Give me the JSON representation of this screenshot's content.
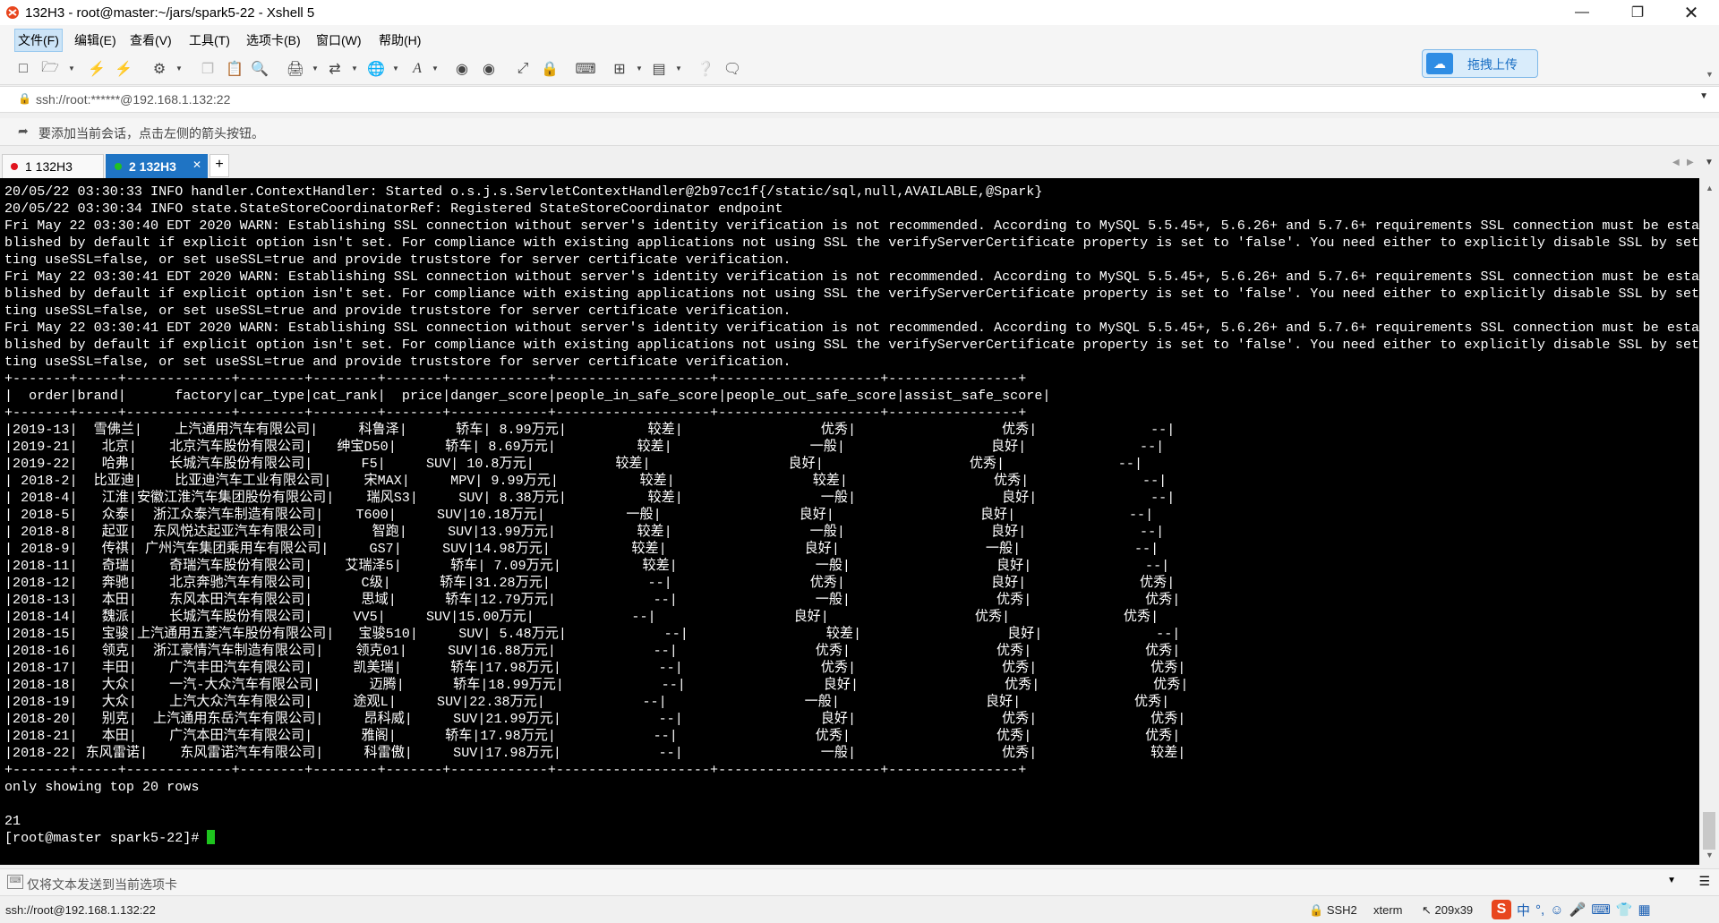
{
  "window": {
    "title": "132H3 - root@master:~/jars/spark5-22 - Xshell 5"
  },
  "menu": [
    "文件(F)",
    "编辑(E)",
    "查看(V)",
    "工具(T)",
    "选项卡(B)",
    "窗口(W)",
    "帮助(H)"
  ],
  "upload_button": {
    "label": "拖拽上传"
  },
  "address_bar": {
    "value": "ssh://root:******@192.168.1.132:22"
  },
  "hint_bar": {
    "text": "要添加当前会话，点击左侧的箭头按钮。"
  },
  "tabs": [
    {
      "label": "1 132H3",
      "status_color": "#e0141e"
    },
    {
      "label": "2 132H3",
      "status_color": "#22c022"
    }
  ],
  "terminal": {
    "lines": [
      "20/05/22 03:30:33 INFO handler.ContextHandler: Started o.s.j.s.ServletContextHandler@2b97cc1f{/static/sql,null,AVAILABLE,@Spark}",
      "20/05/22 03:30:34 INFO state.StateStoreCoordinatorRef: Registered StateStoreCoordinator endpoint",
      "Fri May 22 03:30:40 EDT 2020 WARN: Establishing SSL connection without server's identity verification is not recommended. According to MySQL 5.5.45+, 5.6.26+ and 5.7.6+ requirements SSL connection must be esta",
      "blished by default if explicit option isn't set. For compliance with existing applications not using SSL the verifyServerCertificate property is set to 'false'. You need either to explicitly disable SSL by set",
      "ting useSSL=false, or set useSSL=true and provide truststore for server certificate verification.",
      "Fri May 22 03:30:41 EDT 2020 WARN: Establishing SSL connection without server's identity verification is not recommended. According to MySQL 5.5.45+, 5.6.26+ and 5.7.6+ requirements SSL connection must be esta",
      "blished by default if explicit option isn't set. For compliance with existing applications not using SSL the verifyServerCertificate property is set to 'false'. You need either to explicitly disable SSL by set",
      "ting useSSL=false, or set useSSL=true and provide truststore for server certificate verification.",
      "Fri May 22 03:30:41 EDT 2020 WARN: Establishing SSL connection without server's identity verification is not recommended. According to MySQL 5.5.45+, 5.6.26+ and 5.7.6+ requirements SSL connection must be esta",
      "blished by default if explicit option isn't set. For compliance with existing applications not using SSL the verifyServerCertificate property is set to 'false'. You need either to explicitly disable SSL by set",
      "ting useSSL=false, or set useSSL=true and provide truststore for server certificate verification.",
      "+-------+-----+-------------+--------+--------+-------+------------+-------------------+--------------------+----------------+",
      "|  order|brand|      factory|car_type|cat_rank|  price|danger_score|people_in_safe_score|people_out_safe_score|assist_safe_score|",
      "+-------+-----+-------------+--------+--------+-------+------------+-------------------+--------------------+----------------+",
      "|2019-13|  雪佛兰|    上汽通用汽车有限公司|     科鲁泽|      轿车| 8.99万元|          较差|                 优秀|                  优秀|              --|",
      "|2019-21|   北京|    北京汽车股份有限公司|   绅宝D50|      轿车| 8.69万元|          较差|                 一般|                  良好|              --|",
      "|2019-22|   哈弗|    长城汽车股份有限公司|      F5|     SUV| 10.8万元|          较差|                 良好|                  优秀|              --|",
      "| 2018-2|  比亚迪|    比亚迪汽车工业有限公司|    宋MAX|     MPV| 9.99万元|          较差|                 较差|                  优秀|              --|",
      "| 2018-4|   江淮|安徽江淮汽车集团股份有限公司|    瑞风S3|     SUV| 8.38万元|          较差|                 一般|                  良好|              --|",
      "| 2018-5|   众泰|  浙江众泰汽车制造有限公司|    T600|     SUV|10.18万元|          一般|                 良好|                  良好|              --|",
      "| 2018-8|   起亚|  东风悦达起亚汽车有限公司|      智跑|     SUV|13.99万元|          较差|                 一般|                  良好|              --|",
      "| 2018-9|   传祺| 广州汽车集团乘用车有限公司|     GS7|     SUV|14.98万元|          较差|                 良好|                  一般|              --|",
      "|2018-11|   奇瑞|    奇瑞汽车股份有限公司|    艾瑞泽5|      轿车| 7.09万元|          较差|                 一般|                  良好|              --|",
      "|2018-12|   奔驰|    北京奔驰汽车有限公司|      C级|      轿车|31.28万元|            --|                 优秀|                  良好|              优秀|",
      "|2018-13|   本田|    东风本田汽车有限公司|      思域|      轿车|12.79万元|            --|                 一般|                  优秀|              优秀|",
      "|2018-14|   魏派|    长城汽车股份有限公司|     VV5|     SUV|15.00万元|            --|                 良好|                  优秀|              优秀|",
      "|2018-15|   宝骏|上汽通用五菱汽车股份有限公司|   宝骏510|     SUV| 5.48万元|            --|                 较差|                  良好|              --|",
      "|2018-16|   领克|  浙江豪情汽车制造有限公司|    领克01|     SUV|16.88万元|            --|                 优秀|                  优秀|              优秀|",
      "|2018-17|   丰田|    广汽丰田汽车有限公司|     凯美瑞|      轿车|17.98万元|            --|                 优秀|                  优秀|              优秀|",
      "|2018-18|   大众|    一汽-大众汽车有限公司|      迈腾|      轿车|18.99万元|            --|                 良好|                  优秀|              优秀|",
      "|2018-19|   大众|    上汽大众汽车有限公司|     途观L|     SUV|22.38万元|            --|                 一般|                  良好|              优秀|",
      "|2018-20|   别克|  上汽通用东岳汽车有限公司|     昂科威|     SUV|21.99万元|            --|                 良好|                  优秀|              优秀|",
      "|2018-21|   本田|    广汽本田汽车有限公司|      雅阁|      轿车|17.98万元|            --|                 优秀|                  优秀|              优秀|",
      "|2018-22| 东风雷诺|    东风雷诺汽车有限公司|     科雷傲|     SUV|17.98万元|            --|                 一般|                  优秀|              较差|",
      "+-------+-----+-------------+--------+--------+-------+------------+-------------------+--------------------+----------------+",
      "only showing top 20 rows",
      "",
      "21"
    ],
    "prompt": "[root@master spark5-22]# "
  },
  "send_bar": {
    "text": "仅将文本发送到当前选项卡"
  },
  "status_bar": {
    "address": "ssh://root@192.168.1.132:22",
    "protocol": "SSH2",
    "term": "xterm",
    "size": "209x39",
    "ime_mode": "中"
  }
}
